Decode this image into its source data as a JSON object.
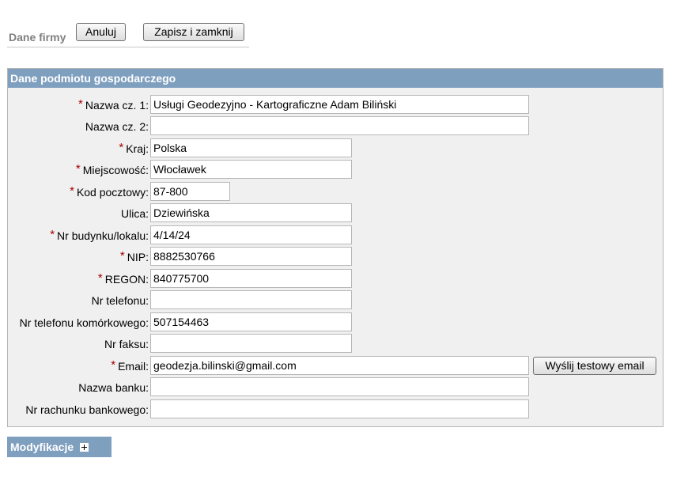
{
  "toolbar": {
    "title": "Dane firmy",
    "cancel_label": "Anuluj",
    "save_close_label": "Zapisz i zamknij"
  },
  "panel": {
    "title": "Dane podmiotu gospodarczego",
    "required_marker": "*",
    "fields": {
      "name1": {
        "label": "Nazwa cz. 1:",
        "value": "Usługi Geodezyjno - Kartograficzne Adam Biliński"
      },
      "name2": {
        "label": "Nazwa cz. 2:",
        "value": ""
      },
      "country": {
        "label": "Kraj:",
        "value": "Polska"
      },
      "city": {
        "label": "Miejscowość:",
        "value": "Włocławek"
      },
      "postal": {
        "label": "Kod pocztowy:",
        "value": "87-800"
      },
      "street": {
        "label": "Ulica:",
        "value": "Dziewińska"
      },
      "building": {
        "label": "Nr budynku/lokalu:",
        "value": "4/14/24"
      },
      "nip": {
        "label": "NIP:",
        "value": "8882530766"
      },
      "regon": {
        "label": "REGON:",
        "value": "840775700"
      },
      "phone": {
        "label": "Nr telefonu:",
        "value": ""
      },
      "mobile": {
        "label": "Nr telefonu komórkowego:",
        "value": "507154463"
      },
      "fax": {
        "label": "Nr faksu:",
        "value": ""
      },
      "email": {
        "label": "Email:",
        "value": "geodezja.bilinski@gmail.com"
      },
      "bank_name": {
        "label": "Nazwa banku:",
        "value": ""
      },
      "bank_account": {
        "label": "Nr rachunku bankowego:",
        "value": ""
      }
    },
    "test_email_label": "Wyślij testowy email"
  },
  "modifications": {
    "title": "Modyfikacje",
    "expand_icon": "plus-box-icon"
  },
  "colors": {
    "header_bg": "#7f9fbf",
    "required": "#a80000",
    "panel_bg": "#f0f0f0"
  }
}
